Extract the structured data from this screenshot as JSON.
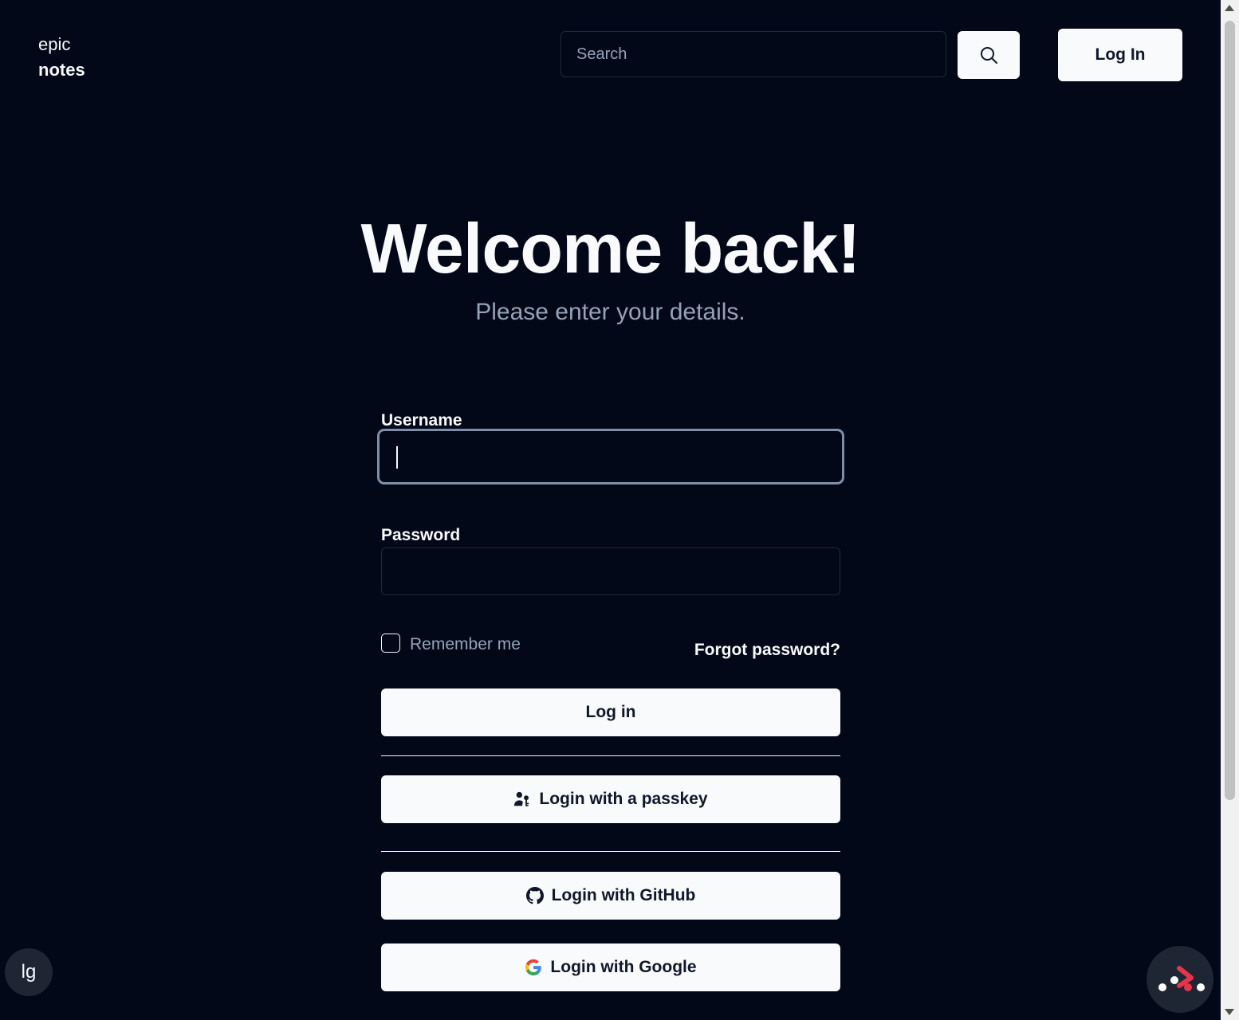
{
  "header": {
    "logo_line1": "epic",
    "logo_line2": "notes",
    "search_placeholder": "Search",
    "search_icon": "search-icon",
    "login_label": "Log In"
  },
  "main": {
    "title": "Welcome back!",
    "subtitle": "Please enter your details.",
    "username_label": "Username",
    "username_value": "",
    "password_label": "Password",
    "password_value": "",
    "remember_label": "Remember me",
    "remember_checked": false,
    "forgot_label": "Forgot password?",
    "login_button": "Log in",
    "passkey_button": "Login with a passkey",
    "passkey_icon": "passkey-icon",
    "github_button": "Login with GitHub",
    "github_icon": "github-icon",
    "google_button": "Login with Google",
    "google_icon": "google-icon"
  },
  "footer": {
    "breakpoint_badge": "lg",
    "devtools_icon": "devtools-icon"
  },
  "colors": {
    "background": "#020817",
    "foreground": "#f8fafc",
    "muted": "#94a3b8",
    "border": "#1e293b",
    "accent_red": "#e8334a"
  }
}
